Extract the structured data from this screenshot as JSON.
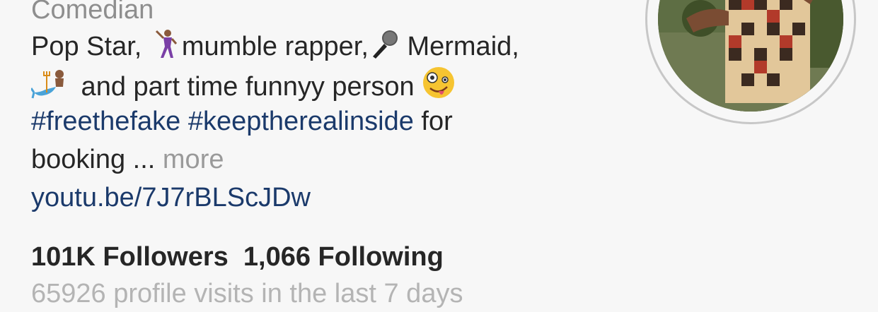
{
  "profile": {
    "category": "Comedian",
    "bio": {
      "line1_a": "Pop Star, ",
      "line1_b": "mumble rapper,",
      "line1_c": " Mermaid,",
      "line2_a": " and part time funnyy person ",
      "hashtag1": "#freethefake",
      "hashtag2": "#keeptherealinside",
      "line3_tail": " for",
      "line4": "booking ... ",
      "more_label": "more",
      "link": "youtu.be/7J7rBLScJDw"
    },
    "emojis": [
      "man-dancing-emoji",
      "microphone-emoji",
      "merman-emoji",
      "zany-face-emoji"
    ],
    "followers_label": "101K Followers",
    "following_label": "1,066 Following",
    "visits_label": "65926 profile visits in the last 7 days"
  },
  "colors": {
    "background": "#f7f7f7",
    "text": "#262626",
    "secondary": "#8e8e8e",
    "link": "#1b3a6b"
  }
}
